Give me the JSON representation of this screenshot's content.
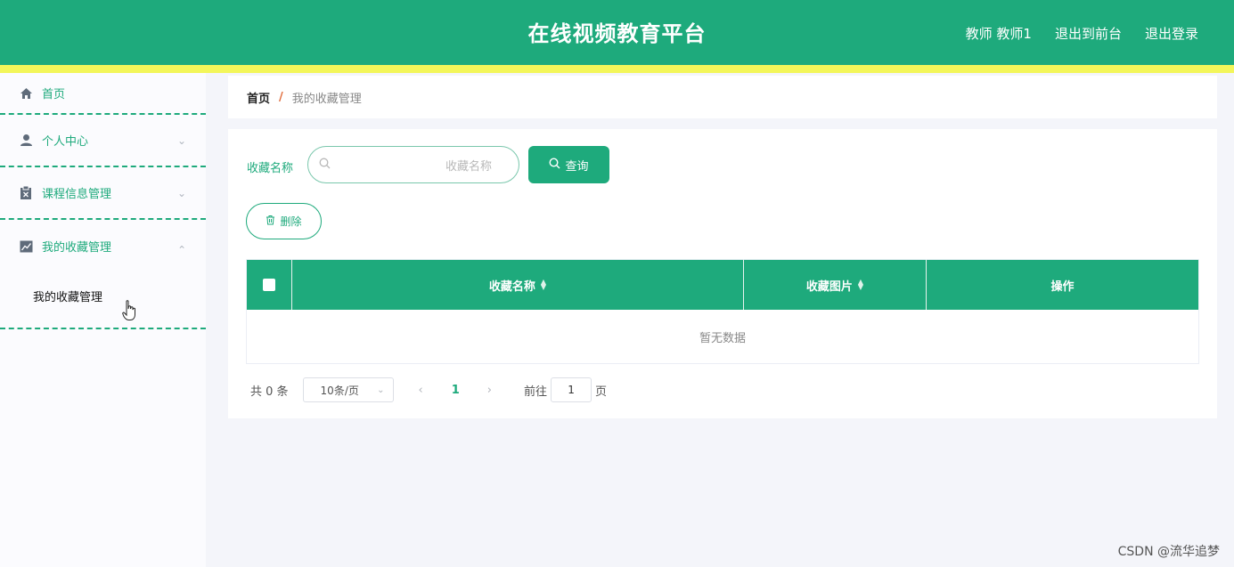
{
  "header": {
    "title": "在线视频教育平台",
    "user": "教师 教师1",
    "to_front": "退出到前台",
    "logout": "退出登录"
  },
  "sidebar": {
    "items": [
      {
        "label": "首页",
        "icon": "home-icon"
      },
      {
        "label": "个人中心",
        "icon": "user-icon",
        "expanded": false
      },
      {
        "label": "课程信息管理",
        "icon": "clipboard-icon",
        "expanded": false
      },
      {
        "label": "我的收藏管理",
        "icon": "chart-icon",
        "expanded": true
      }
    ],
    "submenu": {
      "label": "我的收藏管理"
    }
  },
  "breadcrumb": {
    "home": "首页",
    "separator": "/",
    "current": "我的收藏管理"
  },
  "search": {
    "label": "收藏名称",
    "placeholder": "收藏名称",
    "query_label": "查询"
  },
  "actions": {
    "delete_label": "删除"
  },
  "table": {
    "columns": [
      "收藏名称",
      "收藏图片",
      "操作"
    ],
    "empty_text": "暂无数据"
  },
  "pagination": {
    "total": "共 0 条",
    "page_size": "10条/页",
    "current_page": "1",
    "goto_prefix": "前往",
    "goto_value": "1",
    "goto_suffix": "页"
  },
  "watermark": "CSDN @流华追梦",
  "colors": {
    "primary": "#1eaa7c",
    "stripe": "#f3f65a"
  }
}
